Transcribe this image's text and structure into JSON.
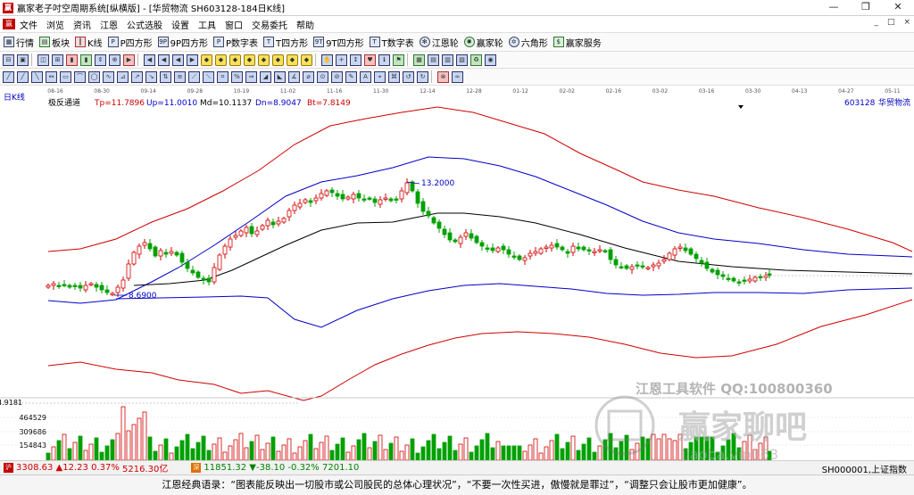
{
  "window": {
    "title": "赢家老子吋空周期系统[纵横版] - [华贸物流  SH603128-184日K线]",
    "minimize": "—",
    "restore": "❐",
    "close": "✕"
  },
  "menu": {
    "items": [
      "文件",
      "浏览",
      "资讯",
      "江恩",
      "公式选股",
      "设置",
      "工具",
      "窗口",
      "交易委托",
      "帮助"
    ],
    "right_controls": [
      "_",
      "□",
      "×"
    ]
  },
  "toolbar": {
    "items": [
      {
        "icon": "grid-icon",
        "label": "行情"
      },
      {
        "icon": "blocks-icon",
        "label": "板块"
      },
      {
        "icon": "candle-icon",
        "label": "K线"
      },
      {
        "icon": "p-square-icon",
        "label": "P四方形"
      },
      {
        "icon": "9p-square-icon",
        "label": "9P四方形"
      },
      {
        "icon": "p-number-table-icon",
        "label": "P数字表"
      },
      {
        "icon": "t-square-icon",
        "label": "T四方形"
      },
      {
        "icon": "9t-square-icon",
        "label": "9T四方形"
      },
      {
        "icon": "t-number-table-icon",
        "label": "T数字表"
      },
      {
        "icon": "gann-wheel-icon",
        "label": "江恩轮"
      },
      {
        "icon": "winner-wheel-icon",
        "label": "赢家轮"
      },
      {
        "icon": "hexagon-icon",
        "label": "六角形"
      },
      {
        "icon": "service-icon",
        "label": "赢家服务"
      }
    ]
  },
  "chart_header": {
    "period_label": "日K线",
    "indicator_name": "极反通道",
    "tp": "Tp=11.7896",
    "up": "Up=11.0010",
    "md": "Md=10.1137",
    "dn": "Dn=8.9047",
    "bt": "Bt=7.8149",
    "code": "603128",
    "name": "华贸物流"
  },
  "date_axis": [
    "08-16",
    "08-30",
    "09-14",
    "09-28",
    "10-19",
    "11-02",
    "11-16",
    "11-30",
    "12-14",
    "12-28",
    "01-12",
    "02-02",
    "02-16",
    "03-02",
    "03-16",
    "03-30",
    "04-13",
    "04-27",
    "05-11"
  ],
  "annotations": {
    "high": "13.2000",
    "low": "8.6900"
  },
  "volume_axis": {
    "top": "4.9181",
    "ticks": [
      "464529",
      "309686",
      "154843"
    ]
  },
  "watermark": {
    "line1": "江恩工具软件  QQ:100800360",
    "line2": "赢家聊吧",
    "line3": "jiaoba.vip163"
  },
  "status": {
    "sh_index": "3308.63",
    "sh_change": "▲12.23",
    "sh_pct": "0.37%",
    "sh_amount": "5216.30亿",
    "sz_index": "11851.32",
    "sz_change": "▼-38.10",
    "sz_pct": "-0.32%",
    "sz_amount": "7201.10",
    "right_index": "SH000001,上证指数"
  },
  "quote": "江恩经典语录：“图表能反映出一切股市或公司股民的总体心理状况”，“不要一次性买进，傲慢就是罪过”，“调整只会让股市更加健康”。",
  "colors": {
    "up_candle": "#d00000",
    "down_candle": "#00a000",
    "outer_channel": "#d00000",
    "inner_channel": "#0000c8",
    "mid_line": "#000000"
  },
  "chart_data": {
    "type": "candlestick",
    "price_levels": {
      "Tp": 11.7896,
      "Up": 11.001,
      "Md": 10.1137,
      "Dn": 8.9047,
      "Bt": 7.8149
    },
    "high": 13.2,
    "low": 8.69,
    "ylim": [
      4.9,
      16.0
    ]
  }
}
